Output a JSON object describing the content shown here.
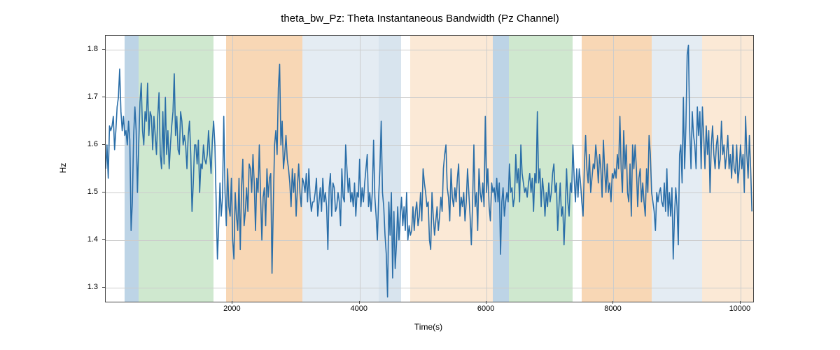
{
  "chart_data": {
    "type": "line",
    "title": "theta_bw_Pz: Theta Instantaneous Bandwidth (Pz Channel)",
    "xlabel": "Time(s)",
    "ylabel": "Hz",
    "xlim": [
      0,
      10200
    ],
    "ylim": [
      1.27,
      1.83
    ],
    "xticks": [
      2000,
      4000,
      6000,
      8000,
      10000
    ],
    "yticks": [
      1.3,
      1.4,
      1.5,
      1.6,
      1.7,
      1.8
    ],
    "bands": [
      {
        "x0": 300,
        "x1": 520,
        "color": "#a7c5de",
        "opacity": 0.75
      },
      {
        "x0": 520,
        "x1": 1700,
        "color": "#bfe0bf",
        "opacity": 0.75
      },
      {
        "x0": 1900,
        "x1": 3100,
        "color": "#f6c99c",
        "opacity": 0.75
      },
      {
        "x0": 3100,
        "x1": 4300,
        "color": "#d6e2ed",
        "opacity": 0.65
      },
      {
        "x0": 4300,
        "x1": 4650,
        "color": "#cbdbe8",
        "opacity": 0.75
      },
      {
        "x0": 4800,
        "x1": 6100,
        "color": "#f9e1c8",
        "opacity": 0.75
      },
      {
        "x0": 6100,
        "x1": 6350,
        "color": "#a7c5de",
        "opacity": 0.75
      },
      {
        "x0": 6350,
        "x1": 7350,
        "color": "#bfe0bf",
        "opacity": 0.75
      },
      {
        "x0": 7500,
        "x1": 8600,
        "color": "#f6c99c",
        "opacity": 0.75
      },
      {
        "x0": 8600,
        "x1": 9400,
        "color": "#d6e2ed",
        "opacity": 0.65
      },
      {
        "x0": 9400,
        "x1": 10200,
        "color": "#f9e1c8",
        "opacity": 0.75
      }
    ],
    "series": [
      {
        "name": "theta_bw_Pz",
        "x_start": 0,
        "x_step": 20,
        "values": [
          1.55,
          1.6,
          1.53,
          1.64,
          1.63,
          1.64,
          1.66,
          1.59,
          1.63,
          1.68,
          1.7,
          1.76,
          1.67,
          1.63,
          1.66,
          1.62,
          1.63,
          1.6,
          1.65,
          1.61,
          1.42,
          1.48,
          1.62,
          1.68,
          1.63,
          1.5,
          1.6,
          1.69,
          1.73,
          1.63,
          1.6,
          1.67,
          1.65,
          1.73,
          1.62,
          1.67,
          1.66,
          1.59,
          1.66,
          1.62,
          1.58,
          1.66,
          1.71,
          1.58,
          1.55,
          1.67,
          1.56,
          1.7,
          1.58,
          1.63,
          1.55,
          1.6,
          1.64,
          1.67,
          1.75,
          1.62,
          1.66,
          1.59,
          1.58,
          1.67,
          1.65,
          1.6,
          1.62,
          1.6,
          1.55,
          1.62,
          1.65,
          1.58,
          1.46,
          1.52,
          1.6,
          1.6,
          1.56,
          1.61,
          1.5,
          1.56,
          1.55,
          1.6,
          1.57,
          1.56,
          1.58,
          1.63,
          1.58,
          1.54,
          1.61,
          1.65,
          1.6,
          1.48,
          1.36,
          1.43,
          1.52,
          1.45,
          1.49,
          1.66,
          1.5,
          1.43,
          1.55,
          1.47,
          1.45,
          1.53,
          1.4,
          1.36,
          1.5,
          1.45,
          1.42,
          1.53,
          1.38,
          1.51,
          1.57,
          1.43,
          1.46,
          1.51,
          1.46,
          1.56,
          1.55,
          1.5,
          1.58,
          1.52,
          1.42,
          1.53,
          1.5,
          1.6,
          1.49,
          1.4,
          1.49,
          1.51,
          1.43,
          1.55,
          1.49,
          1.53,
          1.54,
          1.33,
          1.47,
          1.6,
          1.63,
          1.58,
          1.72,
          1.77,
          1.6,
          1.65,
          1.55,
          1.58,
          1.62,
          1.57,
          1.55,
          1.52,
          1.47,
          1.55,
          1.5,
          1.54,
          1.45,
          1.51,
          1.56,
          1.5,
          1.47,
          1.53,
          1.52,
          1.5,
          1.54,
          1.48,
          1.55,
          1.49,
          1.46,
          1.48,
          1.48,
          1.5,
          1.53,
          1.45,
          1.48,
          1.51,
          1.46,
          1.53,
          1.48,
          1.5,
          1.47,
          1.38,
          1.51,
          1.54,
          1.45,
          1.52,
          1.51,
          1.46,
          1.47,
          1.5,
          1.48,
          1.43,
          1.55,
          1.49,
          1.48,
          1.6,
          1.55,
          1.5,
          1.53,
          1.48,
          1.5,
          1.47,
          1.52,
          1.45,
          1.5,
          1.49,
          1.57,
          1.47,
          1.51,
          1.48,
          1.52,
          1.55,
          1.58,
          1.47,
          1.5,
          1.46,
          1.5,
          1.61,
          1.49,
          1.45,
          1.4,
          1.49,
          1.55,
          1.65,
          1.5,
          1.47,
          1.41,
          1.37,
          1.28,
          1.48,
          1.41,
          1.5,
          1.32,
          1.46,
          1.34,
          1.39,
          1.47,
          1.4,
          1.45,
          1.49,
          1.43,
          1.47,
          1.42,
          1.5,
          1.4,
          1.43,
          1.41,
          1.42,
          1.47,
          1.42,
          1.46,
          1.48,
          1.43,
          1.45,
          1.5,
          1.44,
          1.55,
          1.52,
          1.5,
          1.47,
          1.48,
          1.4,
          1.38,
          1.5,
          1.45,
          1.41,
          1.44,
          1.47,
          1.42,
          1.45,
          1.49,
          1.46,
          1.55,
          1.58,
          1.6,
          1.51,
          1.49,
          1.44,
          1.55,
          1.49,
          1.47,
          1.51,
          1.48,
          1.53,
          1.56,
          1.45,
          1.49,
          1.47,
          1.5,
          1.44,
          1.48,
          1.55,
          1.5,
          1.45,
          1.39,
          1.48,
          1.6,
          1.47,
          1.5,
          1.42,
          1.55,
          1.5,
          1.48,
          1.52,
          1.47,
          1.66,
          1.5,
          1.55,
          1.47,
          1.44,
          1.52,
          1.5,
          1.51,
          1.48,
          1.53,
          1.48,
          1.52,
          1.37,
          1.48,
          1.51,
          1.45,
          1.48,
          1.5,
          1.48,
          1.56,
          1.5,
          1.51,
          1.47,
          1.49,
          1.58,
          1.52,
          1.55,
          1.48,
          1.6,
          1.54,
          1.52,
          1.5,
          1.51,
          1.49,
          1.52,
          1.54,
          1.5,
          1.53,
          1.46,
          1.54,
          1.52,
          1.67,
          1.52,
          1.55,
          1.47,
          1.53,
          1.5,
          1.45,
          1.5,
          1.47,
          1.52,
          1.48,
          1.5,
          1.54,
          1.56,
          1.5,
          1.52,
          1.42,
          1.47,
          1.52,
          1.45,
          1.47,
          1.39,
          1.46,
          1.55,
          1.48,
          1.45,
          1.52,
          1.5,
          1.6,
          1.53,
          1.48,
          1.55,
          1.49,
          1.55,
          1.52,
          1.48,
          1.45,
          1.55,
          1.62,
          1.55,
          1.52,
          1.58,
          1.5,
          1.53,
          1.56,
          1.55,
          1.6,
          1.57,
          1.52,
          1.58,
          1.55,
          1.49,
          1.61,
          1.55,
          1.5,
          1.56,
          1.5,
          1.52,
          1.48,
          1.54,
          1.53,
          1.55,
          1.53,
          1.58,
          1.55,
          1.66,
          1.55,
          1.5,
          1.63,
          1.55,
          1.6,
          1.5,
          1.48,
          1.56,
          1.45,
          1.6,
          1.55,
          1.6,
          1.55,
          1.47,
          1.53,
          1.55,
          1.48,
          1.52,
          1.48,
          1.45,
          1.55,
          1.5,
          1.62,
          1.58,
          1.5,
          1.48,
          1.46,
          1.42,
          1.5,
          1.48,
          1.5,
          1.51,
          1.48,
          1.47,
          1.52,
          1.46,
          1.55,
          1.45,
          1.5,
          1.45,
          1.51,
          1.36,
          1.45,
          1.51,
          1.47,
          1.39,
          1.58,
          1.6,
          1.52,
          1.7,
          1.55,
          1.64,
          1.79,
          1.81,
          1.63,
          1.55,
          1.67,
          1.62,
          1.6,
          1.55,
          1.68,
          1.62,
          1.67,
          1.55,
          1.68,
          1.62,
          1.55,
          1.64,
          1.58,
          1.63,
          1.5,
          1.6,
          1.64,
          1.58,
          1.55,
          1.6,
          1.62,
          1.55,
          1.57,
          1.65,
          1.58,
          1.6,
          1.55,
          1.58,
          1.62,
          1.55,
          1.58,
          1.53,
          1.6,
          1.55,
          1.54,
          1.6,
          1.52,
          1.55,
          1.6,
          1.55,
          1.58,
          1.5,
          1.66,
          1.58,
          1.53,
          1.62,
          1.55,
          1.46
        ]
      }
    ]
  }
}
